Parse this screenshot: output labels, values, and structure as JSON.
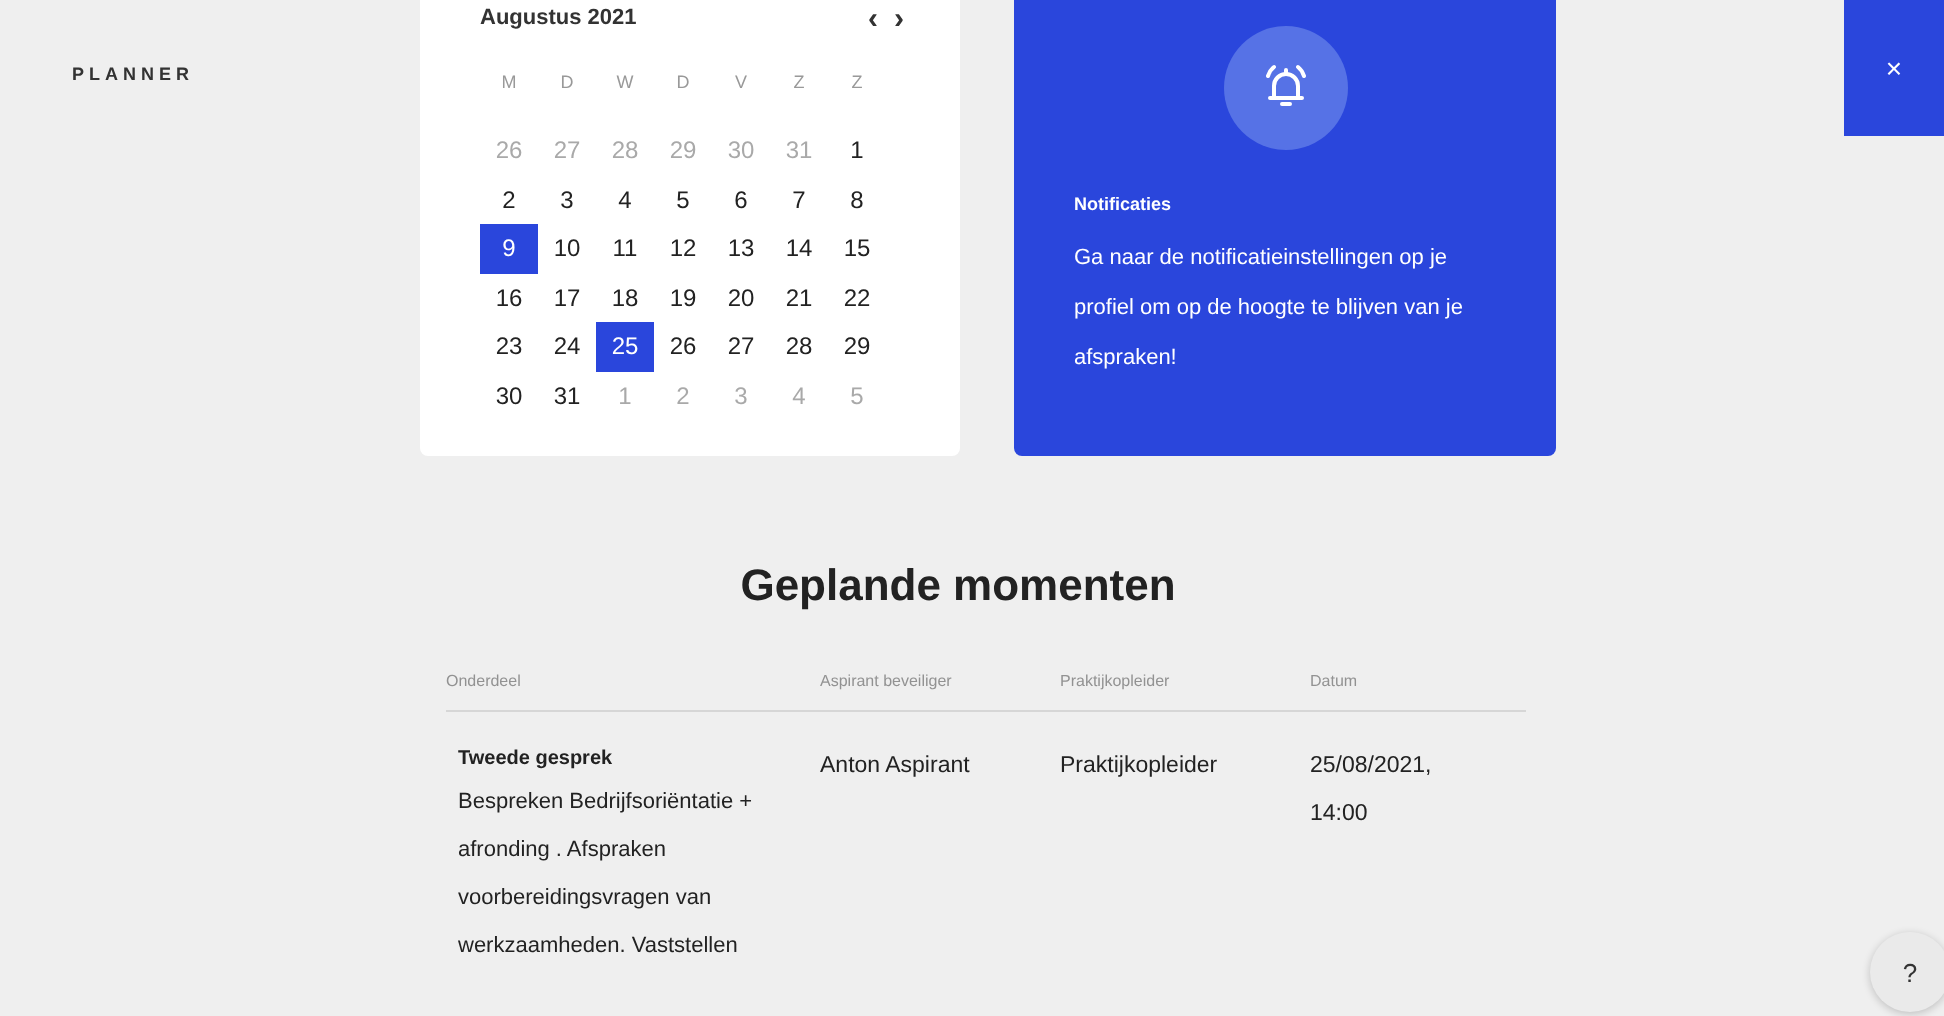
{
  "app_title": "PLANNER",
  "calendar": {
    "month": "Augustus 2021",
    "prev": "‹",
    "next": "›",
    "weekdays": [
      "M",
      "D",
      "W",
      "D",
      "V",
      "Z",
      "Z"
    ],
    "days": [
      {
        "label": "26",
        "muted": true,
        "selected": false
      },
      {
        "label": "27",
        "muted": true,
        "selected": false
      },
      {
        "label": "28",
        "muted": true,
        "selected": false
      },
      {
        "label": "29",
        "muted": true,
        "selected": false
      },
      {
        "label": "30",
        "muted": true,
        "selected": false
      },
      {
        "label": "31",
        "muted": true,
        "selected": false
      },
      {
        "label": "1",
        "muted": false,
        "selected": false
      },
      {
        "label": "2",
        "muted": false,
        "selected": false
      },
      {
        "label": "3",
        "muted": false,
        "selected": false
      },
      {
        "label": "4",
        "muted": false,
        "selected": false
      },
      {
        "label": "5",
        "muted": false,
        "selected": false
      },
      {
        "label": "6",
        "muted": false,
        "selected": false
      },
      {
        "label": "7",
        "muted": false,
        "selected": false
      },
      {
        "label": "8",
        "muted": false,
        "selected": false
      },
      {
        "label": "9",
        "muted": false,
        "selected": true
      },
      {
        "label": "10",
        "muted": false,
        "selected": false
      },
      {
        "label": "11",
        "muted": false,
        "selected": false
      },
      {
        "label": "12",
        "muted": false,
        "selected": false
      },
      {
        "label": "13",
        "muted": false,
        "selected": false
      },
      {
        "label": "14",
        "muted": false,
        "selected": false
      },
      {
        "label": "15",
        "muted": false,
        "selected": false
      },
      {
        "label": "16",
        "muted": false,
        "selected": false
      },
      {
        "label": "17",
        "muted": false,
        "selected": false
      },
      {
        "label": "18",
        "muted": false,
        "selected": false
      },
      {
        "label": "19",
        "muted": false,
        "selected": false
      },
      {
        "label": "20",
        "muted": false,
        "selected": false
      },
      {
        "label": "21",
        "muted": false,
        "selected": false
      },
      {
        "label": "22",
        "muted": false,
        "selected": false
      },
      {
        "label": "23",
        "muted": false,
        "selected": false
      },
      {
        "label": "24",
        "muted": false,
        "selected": false
      },
      {
        "label": "25",
        "muted": false,
        "selected": true
      },
      {
        "label": "26",
        "muted": false,
        "selected": false
      },
      {
        "label": "27",
        "muted": false,
        "selected": false
      },
      {
        "label": "28",
        "muted": false,
        "selected": false
      },
      {
        "label": "29",
        "muted": false,
        "selected": false
      },
      {
        "label": "30",
        "muted": false,
        "selected": false
      },
      {
        "label": "31",
        "muted": false,
        "selected": false
      },
      {
        "label": "1",
        "muted": true,
        "selected": false
      },
      {
        "label": "2",
        "muted": true,
        "selected": false
      },
      {
        "label": "3",
        "muted": true,
        "selected": false
      },
      {
        "label": "4",
        "muted": true,
        "selected": false
      },
      {
        "label": "5",
        "muted": true,
        "selected": false
      }
    ]
  },
  "notification": {
    "title": "Notificaties",
    "text": "Ga naar de notificatieinstellingen op je profiel om op de hoogte te blijven van je afspraken!"
  },
  "close_button": "×",
  "section_title": "Geplande momenten",
  "table": {
    "columns": [
      "Onderdeel",
      "Aspirant beveiliger",
      "Praktijkopleider",
      "Datum"
    ],
    "rows": [
      {
        "title": "Tweede gesprek",
        "description": "Bespreken Bedrijfsoriëntatie + afronding . Afspraken voorbereidingsvragen van werkzaamheden. Vaststellen",
        "aspirant": "Anton Aspirant",
        "praktijkopleider": "Praktijkopleider",
        "datum": "25/08/2021, 14:00"
      }
    ]
  },
  "help_button": "?"
}
